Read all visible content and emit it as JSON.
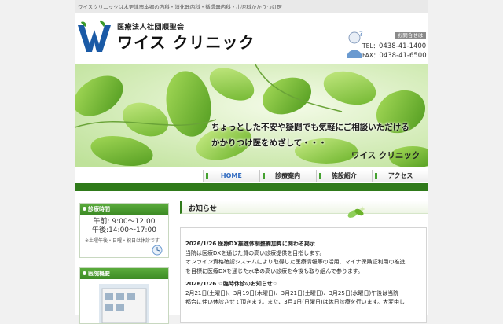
{
  "header": {
    "tagline": "ワイスクリニックは木更津市本郷の内科・消化器内科・循環器内科・小児科かかりつけ医",
    "corp_name": "医療法人社団順聖会",
    "clinic_name": "ワイス クリニック",
    "contact_badge": "お問合せは",
    "tel_label": "TEL：",
    "tel_number": "0438-41-1400",
    "fax_label": "FAX：",
    "fax_number": "0438-41-6500"
  },
  "hero": {
    "line1": "ちょっとした不安や疑問でも気軽にご相談いただける",
    "line2": "かかりつけ医をめざして・・・",
    "logo": "ワイス クリニック"
  },
  "nav": {
    "items": [
      {
        "label": "HOME"
      },
      {
        "label": "診療案内"
      },
      {
        "label": "施設紹介"
      },
      {
        "label": "アクセス"
      }
    ]
  },
  "sidebar": {
    "hours_title": "診療時間",
    "hours_am": "午前: 9:00～12:00",
    "hours_pm": "午後:14:00～17:00",
    "hours_note": "※土曜午後・日曜・祝日は休診です",
    "overview_title": "医院概要"
  },
  "main": {
    "news_title": "お知らせ",
    "news": [
      {
        "title": "2026/1/26 医療DX推進体制整備加算に関わる掲示",
        "lines": [
          "当院は医療DXを通じた質の高い診療提供を目指します。",
          "オンライン資格確認システムにより取得した医療情報等の活用、マイナ保険証利用の推進",
          "を目標に医療DXを通じた水準の高い診療を今後も取り組んで参ります。"
        ]
      },
      {
        "title": "2026/1/26 ☆臨時休診のお知らせ☆",
        "lines": [
          "2月21日(土曜日)、3月19日(木曜日)、3月21日(土曜日)、3月25日(水曜日)午後は当院",
          "都合に伴い休診させて頂きます。また、3月1日(日曜日)は休日診療を行います。大変申し"
        ]
      }
    ]
  },
  "colors": {
    "accent_green": "#2f7a1a",
    "nav_active": "#2e6ac0",
    "logo_blue": "#1a5aa6"
  }
}
